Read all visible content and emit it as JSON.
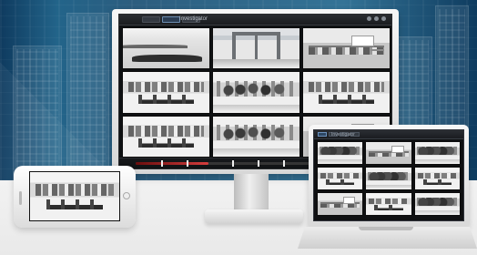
{
  "desktop": {
    "window_title": "Investigator",
    "tabs": [
      "",
      "",
      ""
    ],
    "active_tab": 1,
    "grid_tiles": [
      "parking",
      "hall",
      "office",
      "store",
      "crowd",
      "store",
      "store",
      "crowd",
      "office"
    ],
    "timeline_progress_percent": 34,
    "timeline_markers_percent": [
      12,
      24,
      45,
      57,
      69
    ],
    "transport_buttons": 5,
    "active_transport_button": 2
  },
  "phone": {
    "tile": "store"
  },
  "laptop": {
    "window_title": "Investigator",
    "tabs": [
      "",
      "",
      "",
      ""
    ],
    "active_tab": 0,
    "grid_tiles": [
      "crowd",
      "office",
      "crowd",
      "store",
      "crowd",
      "store",
      "office",
      "store",
      "crowd"
    ]
  },
  "colors": {
    "accent_blue": "#6b91bc",
    "timeline_red": "#d53d3d"
  },
  "icons": {
    "window_controls": [
      "minimize-icon",
      "maximize-icon",
      "close-icon"
    ],
    "phone_button": "home-button-icon"
  }
}
